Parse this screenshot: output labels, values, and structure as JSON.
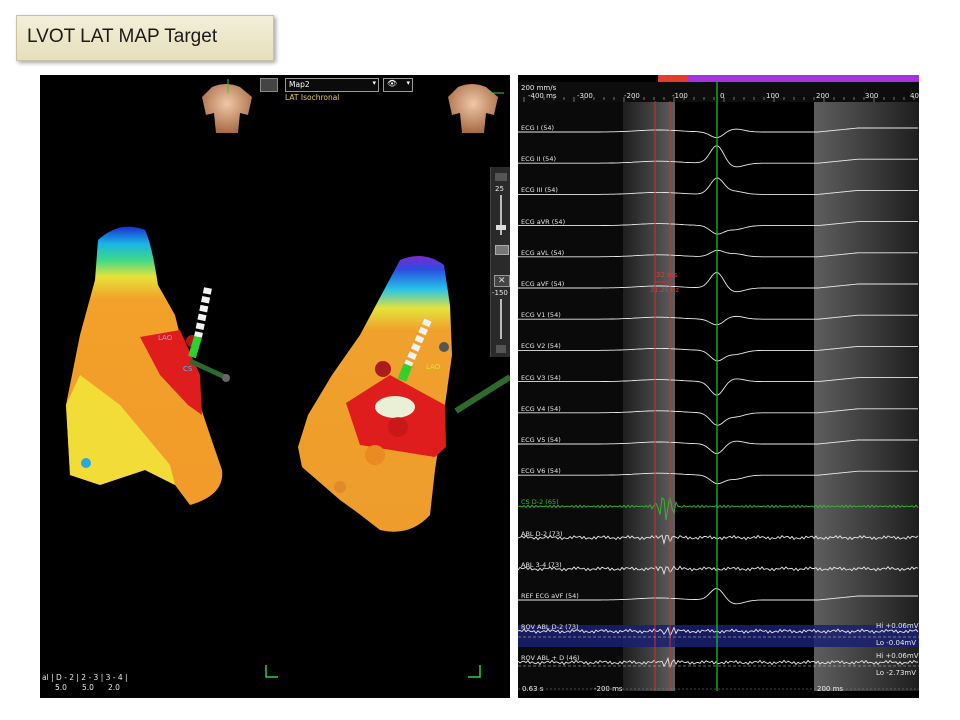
{
  "slide_title": "LVOT LAT MAP Target",
  "map_viewer": {
    "map_select": "Map2",
    "map_type": "LAT Isochronal",
    "slider_top_value": "25",
    "slider_bottom_value": "-150",
    "lao_label": "LAO",
    "cs_label": "CS",
    "bottom_channels": "al | D - 2 | 2 - 3 | 3 - 4 |",
    "bottom_values": [
      "5.0",
      "5.0",
      "2.0"
    ]
  },
  "ecg_viewer": {
    "sweep_speed": "200 mm/s",
    "time_ticks": [
      "-400 ms",
      "-300",
      "-200",
      "-100",
      "0",
      "100",
      "200",
      "300",
      "40"
    ],
    "caliper_label": "32 ms",
    "caliper_sub": "31.25 Hz",
    "leads": [
      "ECG I (54)",
      "ECG II (54)",
      "ECG III (54)",
      "ECG aVR (54)",
      "ECG aVL (54)",
      "ECG aVF (54)",
      "ECG V1 (54)",
      "ECG V2 (54)",
      "ECG V3 (54)",
      "ECG V4 (54)",
      "ECG V5 (54)",
      "ECG V6 (54)",
      "CS D-2 (65)",
      "ABL D-2 (73)",
      "ABL 3-4 (73)",
      "REF ECG aVF (54)",
      "ROV ABL D-2 (73)",
      "ROV ABL + D (46)"
    ],
    "hi_1": "Hi +0.06mV",
    "lo_1": "Lo -0.04mV",
    "hi_2": "Hi +0.06mV",
    "lo_2": "Lo -2.73mV",
    "bottom_left": "0.63 s",
    "bottom_mid": "-200 ms",
    "bottom_right": "200 ms"
  },
  "colors": {
    "ecg_trace": "#e8e8e8",
    "cs_trace": "#2fbf2f",
    "marker_red": "#d22b2b",
    "marker_green": "#22c03a",
    "header_purple": "#a533e0"
  }
}
